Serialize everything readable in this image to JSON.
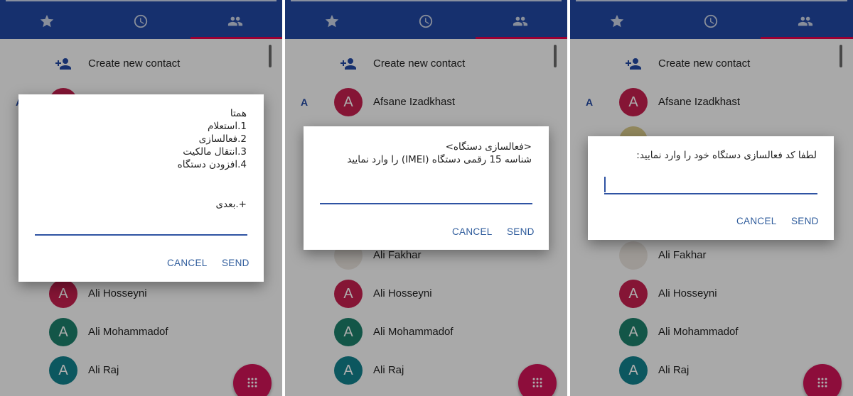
{
  "tabs": {
    "favorites_icon": "star-icon",
    "recents_icon": "clock-icon",
    "contacts_icon": "people-icon"
  },
  "create_contact_label": "Create new contact",
  "section_letter": "A",
  "avatar_initial": "A",
  "contacts": {
    "afsane": "Afsane Izadkhast",
    "fakhar": "Ali Fakhar",
    "hosseyni": "Ali Hosseyni",
    "mohammadof": "Ali Mohammadof",
    "raj": "Ali Raj"
  },
  "colors": {
    "app_bar": "#2147a3",
    "accent_pink": "#e5004a",
    "avatar_crimson": "#c51f4e",
    "avatar_green": "#1d7f6a",
    "avatar_teal": "#12808d",
    "fab": "#d01457"
  },
  "dialogs": {
    "menu": {
      "message": "همتا\n1.استعلام\n2.فعالسازی\n3.انتقال مالکیت\n4.افزودن دستگاه",
      "next": "+.بعدی",
      "cancel": "CANCEL",
      "send": "SEND"
    },
    "imei": {
      "message": "<فعالسازی دستگاه>\nشناسه 15 رقمی دستگاه (IMEI) را وارد نمایید",
      "cancel": "CANCEL",
      "send": "SEND"
    },
    "activation_code": {
      "message": "لطفا کد فعالسازی دستگاه خود را وارد نمایید:",
      "cancel": "CANCEL",
      "send": "SEND"
    }
  }
}
